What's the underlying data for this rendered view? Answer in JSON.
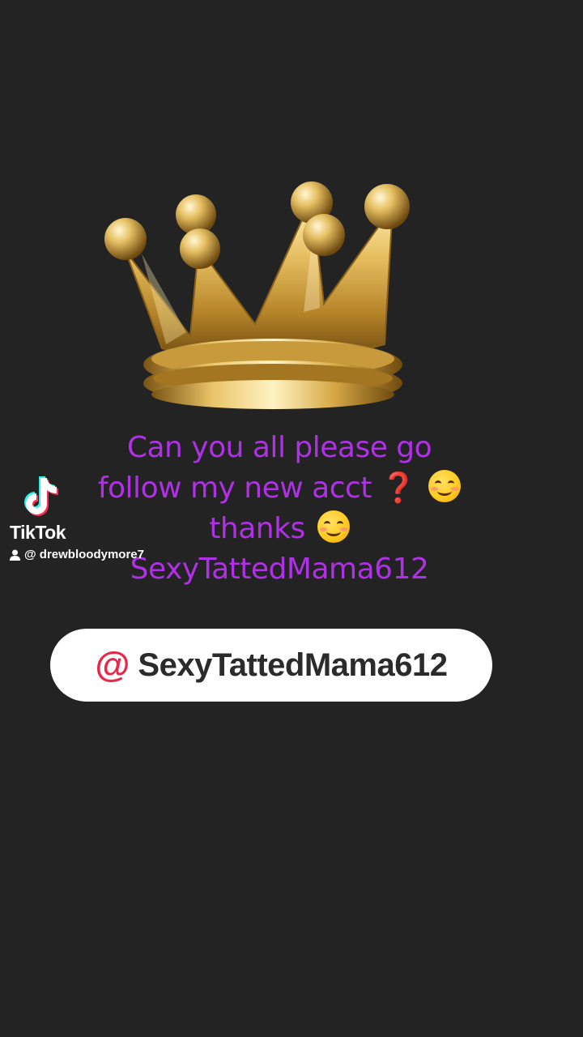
{
  "caption": {
    "line1": "Can you all please go",
    "line2_text": "follow my new acct",
    "line2_symbol": "❓",
    "line2_emoji": "smiling-face-icon",
    "line3_text": "thanks",
    "line3_emoji": "relieved-blushing-face-icon",
    "line4": "SexyTattedMama612",
    "color": "#b030e6"
  },
  "watermark": {
    "brand": "TikTok",
    "username": "@ drewbloodymore7",
    "logo_icon": "tiktok-note-icon",
    "user_icon": "person-icon"
  },
  "mention": {
    "at_symbol": "@",
    "handle": "SexyTattedMama612",
    "at_color": "#e8284a"
  },
  "graphic": {
    "icon": "crown-icon"
  },
  "background": "#232323"
}
